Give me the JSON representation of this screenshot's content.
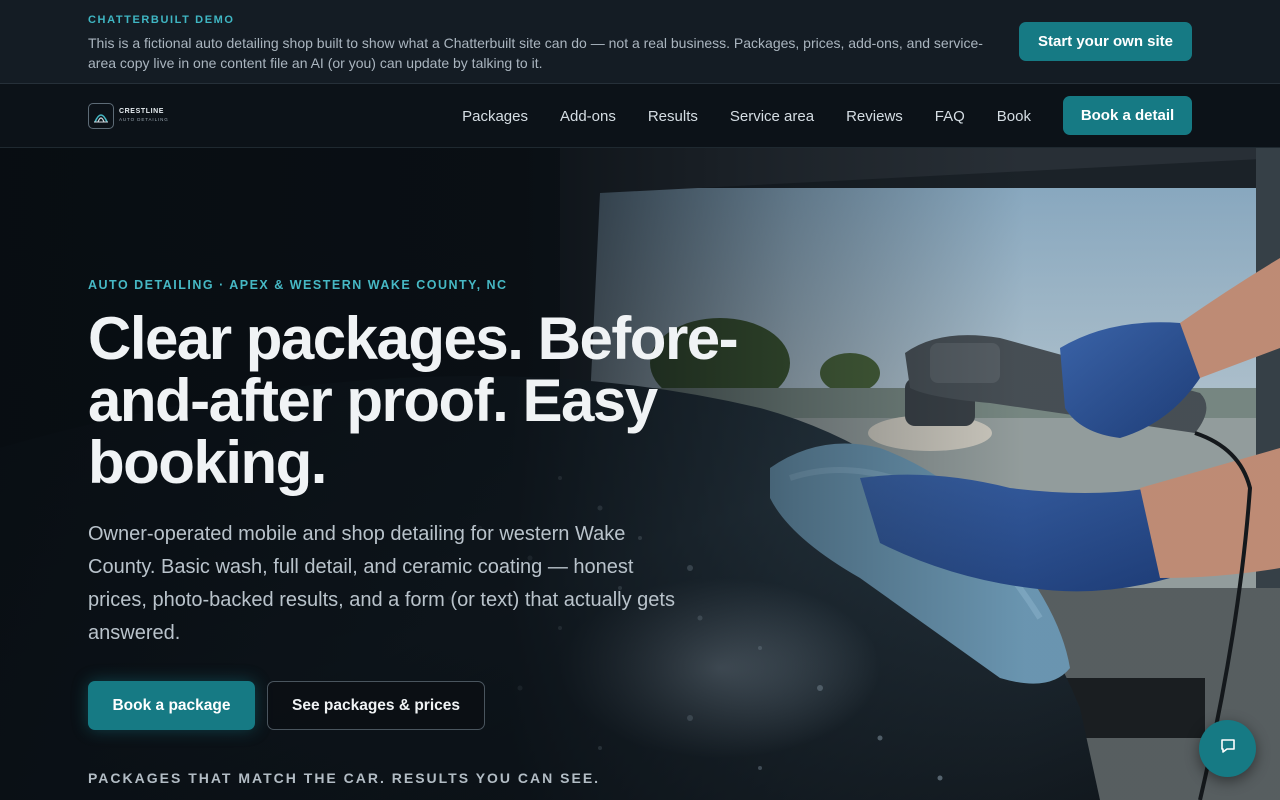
{
  "demo_banner": {
    "label": "CHATTERBUILT DEMO",
    "text": "This is a fictional auto detailing shop built to show what a Chatterbuilt site can do — not a real business. Packages, prices, add-ons, and service-area copy live in one content file an AI (or you) can update by talking to it.",
    "cta": "Start your own site"
  },
  "brand": {
    "name": "CRESTLINE",
    "sub": "AUTO DETAILING",
    "logo_icon": "crest-arch-icon"
  },
  "nav": {
    "items": [
      {
        "label": "Packages"
      },
      {
        "label": "Add-ons"
      },
      {
        "label": "Results"
      },
      {
        "label": "Service area"
      },
      {
        "label": "Reviews"
      },
      {
        "label": "FAQ"
      },
      {
        "label": "Book"
      }
    ],
    "cta": "Book a detail"
  },
  "hero": {
    "eyebrow": "AUTO DETAILING · APEX & WESTERN WAKE COUNTY, NC",
    "headline": "Clear packages. Before-and-after proof. Easy booking.",
    "lede": "Owner-operated mobile and shop detailing for western Wake County. Basic wash, full detail, and ceramic coating — honest prices, photo-backed results, and a form (or text) that actually gets answered.",
    "primary_cta": "Book a package",
    "secondary_cta": "See packages & prices",
    "tagline": "PACKAGES THAT MATCH THE CAR. RESULTS YOU CAN SEE."
  },
  "chat": {
    "icon": "chat-bubble-icon"
  },
  "colors": {
    "accent": "#167a84",
    "eyebrow": "#46b8c4",
    "background": "#0b1116"
  }
}
